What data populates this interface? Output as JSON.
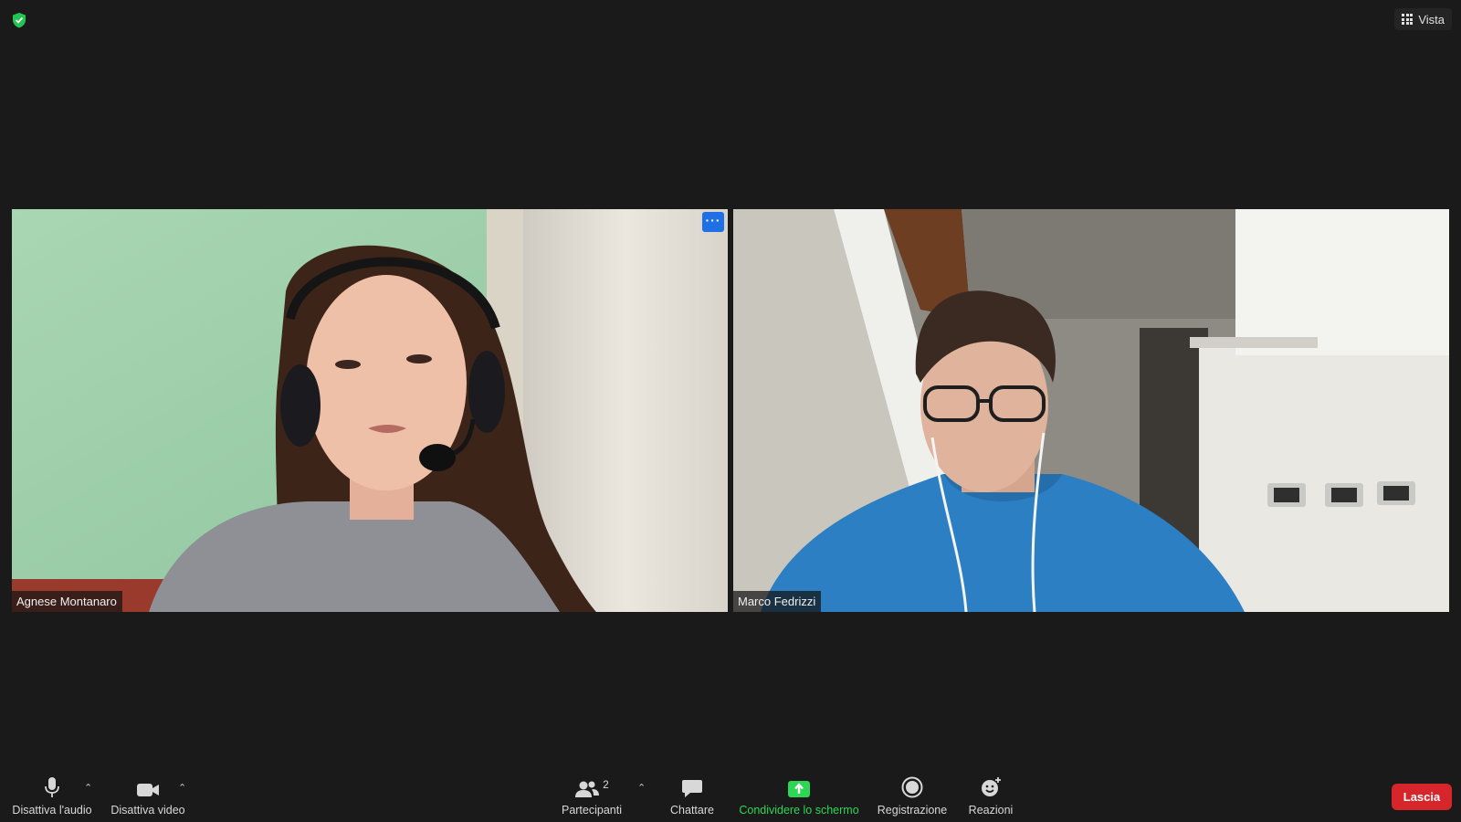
{
  "top": {
    "view_label": "Vista"
  },
  "participants": [
    {
      "name": "Agnese Montanaro",
      "more_label": "···"
    },
    {
      "name": "Marco Fedrizzi"
    }
  ],
  "toolbar": {
    "mute_label": "Disattiva l'audio",
    "video_label": "Disattiva video",
    "participants_label": "Partecipanti",
    "participants_count": "2",
    "chat_label": "Chattare",
    "share_label": "Condividere lo schermo",
    "record_label": "Registrazione",
    "reactions_label": "Reazioni",
    "leave_label": "Lascia"
  },
  "colors": {
    "background": "#1a1a1a",
    "share_green": "#2dd655",
    "leave_red": "#d7262b",
    "security_green": "#23c552",
    "more_blue": "#1f6fe5"
  }
}
